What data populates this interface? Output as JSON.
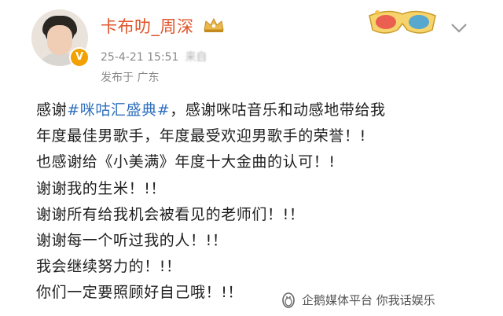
{
  "header": {
    "username": "卡布叻_周深",
    "timestamp": "25-4-21 15:51",
    "source_text": "来自",
    "location": "发布于 广东"
  },
  "post": {
    "lines": [
      {
        "prefix": "感谢",
        "topic": "#咪咕汇盛典#",
        "suffix": "，感谢咪咕音乐和动感地带给我"
      },
      {
        "text": "年度最佳男歌手，年度最受欢迎男歌手的荣誉！!"
      },
      {
        "text": "也感谢给《小美满》年度十大金曲的认可！!"
      },
      {
        "text": "谢谢我的生米！!！"
      },
      {
        "text": "谢谢所有给我机会被看见的老师们！!！"
      },
      {
        "text": "谢谢每一个听过我的人！!！"
      },
      {
        "text": "我会继续努力的！!！"
      },
      {
        "text": "你们一定要照顾好自己哦！!！"
      }
    ]
  },
  "watermark": {
    "text": "企鹅媒体平台 你我话娱乐"
  },
  "colors": {
    "username": "#e0542a",
    "topic_link": "#2f6fbd",
    "meta": "#8a8a8a",
    "verified_badge": "#f2a100"
  },
  "icons": {
    "verified": "verified-badge-icon",
    "crown": "crown-icon",
    "decoration": "3d-glasses-icon",
    "menu": "chevron-down-icon",
    "watermark": "penguin-icon"
  }
}
